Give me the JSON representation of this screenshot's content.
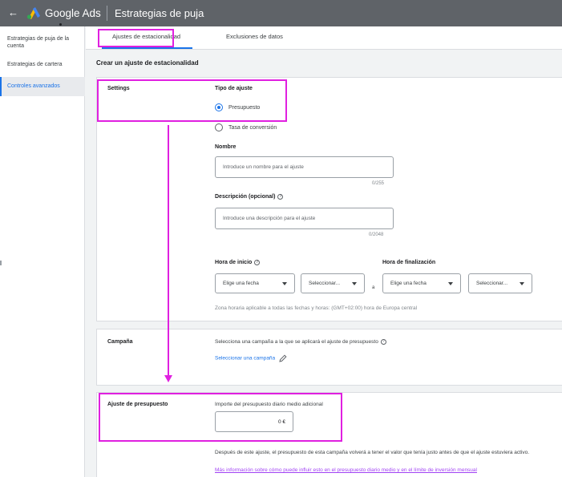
{
  "topbar": {
    "back": "←",
    "brand": "Google Ads",
    "page_title": "Estrategias de puja"
  },
  "sidebar": {
    "items": [
      {
        "label": "Estrategias de puja de la cuenta"
      },
      {
        "label": "Estrategias de cartera"
      },
      {
        "label": "Controles avanzados"
      }
    ]
  },
  "tabs": [
    {
      "label": "Ajustes de estacionalidad"
    },
    {
      "label": "Exclusiones de datos"
    }
  ],
  "section_title": "Crear un ajuste de estacionalidad",
  "settings": {
    "label": "Settings",
    "type_label": "Tipo de ajuste",
    "options": [
      {
        "label": "Presupuesto",
        "selected": true
      },
      {
        "label": "Tasa de conversión",
        "selected": false
      }
    ],
    "name_label": "Nombre",
    "name_placeholder": "Introduce un nombre para el ajuste",
    "name_counter": "0/255",
    "desc_label": "Descripción (opcional)",
    "desc_placeholder": "Introduce una descripción para el ajuste",
    "desc_counter": "0/2048",
    "start_label": "Hora de inicio",
    "end_label": "Hora de finalización",
    "date_select": "Elige una fecha",
    "time_select": "Seleccionar...",
    "range_sep": "a",
    "timezone_note": "Zona horaria aplicable a todas las fechas y horas: (GMT+02:00) hora de Europa central"
  },
  "campaign": {
    "label": "Campaña",
    "description": "Selecciona una campaña a la que se aplicará el ajuste de presupuesto",
    "select_link": "Seleccionar una campaña"
  },
  "budget": {
    "label": "Ajuste de presupuesto",
    "field_label": "Importe del presupuesto diario medio adicional",
    "value": "0 €",
    "note": "Después de este ajuste, el presupuesto de esta campaña volverá a tener el valor que tenía justo antes de que el ajuste estuviera activo.",
    "more_link": "Más información sobre cómo puede influir esto en el presupuesto diario medio y en el límite de inversión mensual"
  },
  "colors": {
    "accent": "#1a73e8",
    "highlight": "#e020e0",
    "topbar": "#5f6368"
  }
}
